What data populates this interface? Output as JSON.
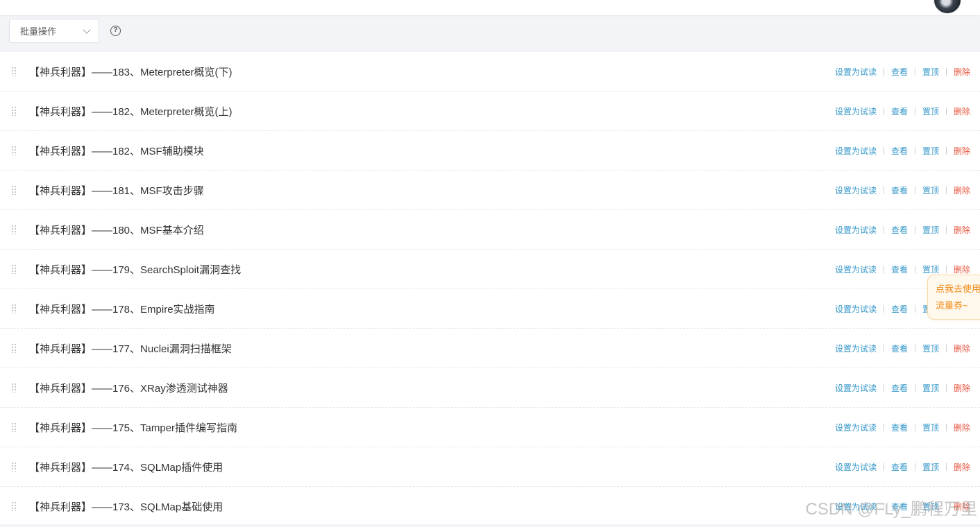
{
  "toolbar": {
    "batch_label": "批量操作",
    "help_icon": "question-circle-icon"
  },
  "actions": {
    "trial": "设置为试读",
    "view": "查看",
    "pin": "置顶",
    "delete": "删除"
  },
  "rows": [
    "【神兵利器】——183、Meterpreter概览(下)",
    "【神兵利器】——182、Meterpreter概览(上)",
    "【神兵利器】——182、MSF辅助模块",
    "【神兵利器】——181、MSF攻击步骤",
    "【神兵利器】——180、MSF基本介绍",
    "【神兵利器】——179、SearchSploit漏洞查找",
    "【神兵利器】——178、Empire实战指南",
    "【神兵利器】——177、Nuclei漏洞扫描框架",
    "【神兵利器】——176、XRay渗透测试神器",
    "【神兵利器】——175、Tamper插件编写指南",
    "【神兵利器】——174、SQLMap插件使用",
    "【神兵利器】——173、SQLMap基础使用"
  ],
  "coupon": {
    "line1": "点我去使用",
    "line2": "流量券~"
  },
  "watermark": "CSDN @FLy_鹏程万里",
  "colors": {
    "link": "#3296c8",
    "danger": "#e8553e",
    "coupon_text": "#f08a18",
    "toolbar_bg": "#f2f4f7"
  }
}
